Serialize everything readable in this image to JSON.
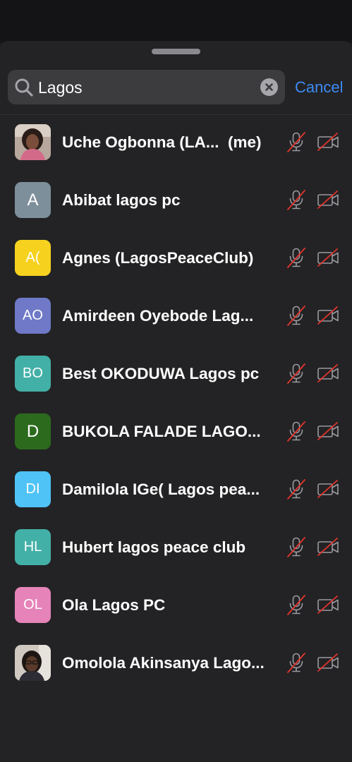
{
  "search": {
    "value": "Lagos",
    "cancel_label": "Cancel"
  },
  "participants": [
    {
      "name": "Uche Ogbonna (LA...  (me)",
      "initials": "",
      "avatar_type": "photo",
      "avatar_color": "#7a5a52",
      "muted": true,
      "video_off": true
    },
    {
      "name": "Abibat lagos pc",
      "initials": "A",
      "avatar_type": "initials",
      "avatar_color": "#7d8f9b",
      "muted": true,
      "video_off": true
    },
    {
      "name": "Agnes (LagosPeaceClub)",
      "initials": "A(",
      "avatar_type": "initials",
      "avatar_color": "#f6d21f",
      "muted": true,
      "video_off": true
    },
    {
      "name": "Amirdeen Oyebode Lag...",
      "initials": "AO",
      "avatar_type": "initials",
      "avatar_color": "#6f79c8",
      "muted": true,
      "video_off": true
    },
    {
      "name": "Best OKODUWA Lagos pc",
      "initials": "BO",
      "avatar_type": "initials",
      "avatar_color": "#43b0a7",
      "muted": true,
      "video_off": true
    },
    {
      "name": "BUKOLA FALADE LAGO...",
      "initials": "D",
      "avatar_type": "initials",
      "avatar_color": "#2c6a1d",
      "muted": true,
      "video_off": true
    },
    {
      "name": "Damilola IGe( Lagos pea...",
      "initials": "DI",
      "avatar_type": "initials",
      "avatar_color": "#4fc3f5",
      "muted": true,
      "video_off": true
    },
    {
      "name": "Hubert lagos peace club",
      "initials": "HL",
      "avatar_type": "initials",
      "avatar_color": "#43b0a7",
      "muted": true,
      "video_off": true
    },
    {
      "name": "Ola Lagos PC",
      "initials": "OL",
      "avatar_type": "initials",
      "avatar_color": "#e684b9",
      "muted": true,
      "video_off": true
    },
    {
      "name": "Omolola Akinsanya Lago...",
      "initials": "",
      "avatar_type": "photo",
      "avatar_color": "#5b5552",
      "muted": true,
      "video_off": true
    }
  ],
  "colors": {
    "accent": "#3d8bf3",
    "muted_slash": "#e5342c",
    "icon_gray": "#9a9aa0"
  }
}
